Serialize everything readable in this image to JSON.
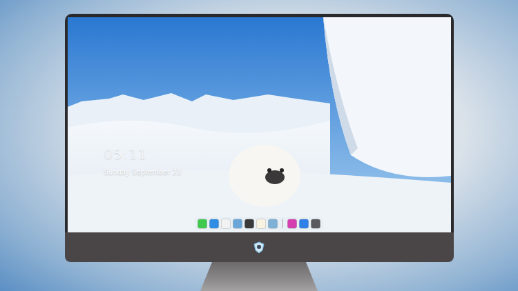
{
  "lock_screen": {
    "time": "05:11",
    "date": "Sunday September 23"
  },
  "dock": {
    "groups": [
      [
        {
          "color": "#3fc94d"
        },
        {
          "color": "#2f8de4"
        },
        {
          "color": "#f2f2f2"
        },
        {
          "color": "#6aa6d8"
        },
        {
          "color": "#3a3a3a"
        },
        {
          "color": "#f7f3e0"
        },
        {
          "color": "#7fb0d6"
        }
      ],
      [
        {
          "color": "#d63fb0"
        },
        {
          "color": "#2f7fe8"
        },
        {
          "color": "#5a5a5e"
        }
      ]
    ]
  }
}
